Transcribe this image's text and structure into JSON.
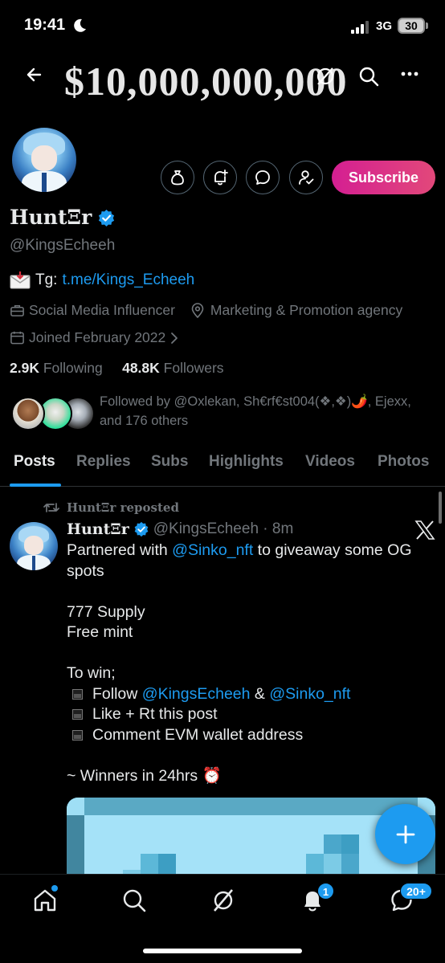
{
  "status_bar": {
    "time": "19:41",
    "network": "3G",
    "battery": "30"
  },
  "header": {
    "title": "$10,000,000,000"
  },
  "profile": {
    "display_name": "HuntΞr",
    "handle": "@KingsEcheeh",
    "bio_prefix": "Tg:",
    "bio_link": "t.me/Kings_Echeeh",
    "category": "Social Media Influencer",
    "location": "Marketing & Promotion agency",
    "joined": "Joined February 2022",
    "following_count": "2.9K",
    "following_label": "Following",
    "followers_count": "48.8K",
    "followers_label": "Followers",
    "followed_by": "Followed by @Oxlekan, Sh€rf€st004(❖,❖)🌶️, Ejexx, and 176 others",
    "subscribe_label": "Subscribe"
  },
  "tabs": [
    {
      "label": "Posts"
    },
    {
      "label": "Replies"
    },
    {
      "label": "Subs"
    },
    {
      "label": "Highlights"
    },
    {
      "label": "Videos"
    },
    {
      "label": "Photos"
    }
  ],
  "post": {
    "repost_label": "HuntΞr reposted",
    "author": "HuntΞr",
    "handle_time": "@KingsEcheeh · 8m",
    "line1_prefix": "Partnered with ",
    "line1_mention": "@Sinko_nft",
    "line1_suffix": " to giveaway some OG",
    "line2": "spots",
    "line3": "777 Supply",
    "line4": "Free mint",
    "line5": "To win;",
    "bullet1_prefix": "Follow ",
    "bullet1_mention1": "@KingsEcheeh",
    "bullet1_amp": " & ",
    "bullet1_mention2": "@Sinko_nft",
    "bullet2": "Like + Rt this post",
    "bullet3": "Comment EVM wallet address",
    "line_winners": "~ Winners in 24hrs ⏰"
  },
  "bottom_nav": {
    "notifications_badge": "1",
    "messages_badge": "20+"
  },
  "colors": {
    "accent": "#1d9bf0",
    "subscribe_gradient_start": "#d41f92",
    "subscribe_gradient_end": "#e2487a",
    "muted": "#71767b",
    "background": "#000000"
  }
}
